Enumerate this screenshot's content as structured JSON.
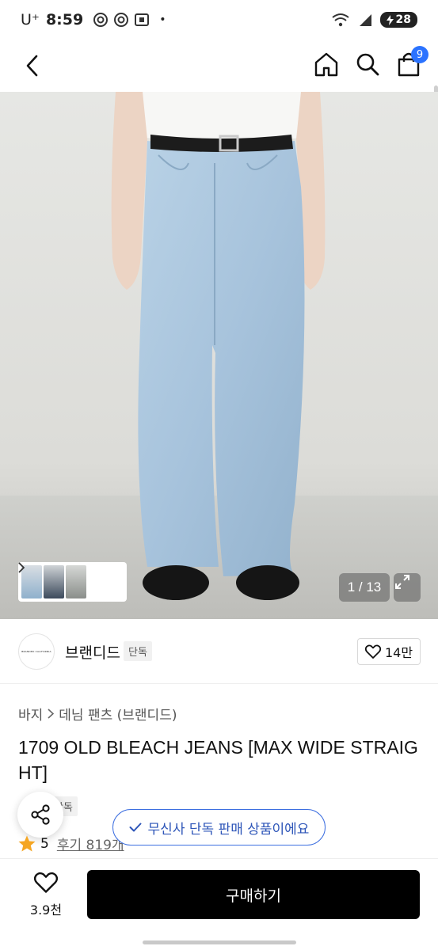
{
  "status_bar": {
    "carrier": "U⁺",
    "time": "8:59",
    "dot": "•",
    "battery": "28"
  },
  "header": {
    "cart_count": "9"
  },
  "gallery": {
    "counter": "1 / 13"
  },
  "brand": {
    "logo_text": "BRANDED CALIFORNIA",
    "name": "브랜디드",
    "tag": "단독",
    "like_count": "14만"
  },
  "product": {
    "breadcrumb": [
      "바지",
      "데님 팬츠 (브랜디드)"
    ],
    "title": "1709 OLD BLEACH JEANS [MAX WIDE STRAIGHT]",
    "exclusive_tag": "단독",
    "rating": "5",
    "reviews": "후기 819개"
  },
  "toast": {
    "text": "무신사 단독 판매 상품이에요"
  },
  "bottom_bar": {
    "wish_count": "3.9천",
    "buy_label": "구매하기"
  },
  "colors": {
    "accent_blue": "#2b73ff",
    "toast_text": "#2d55b8",
    "star": "#f5a623",
    "buy_button": "#000000"
  }
}
